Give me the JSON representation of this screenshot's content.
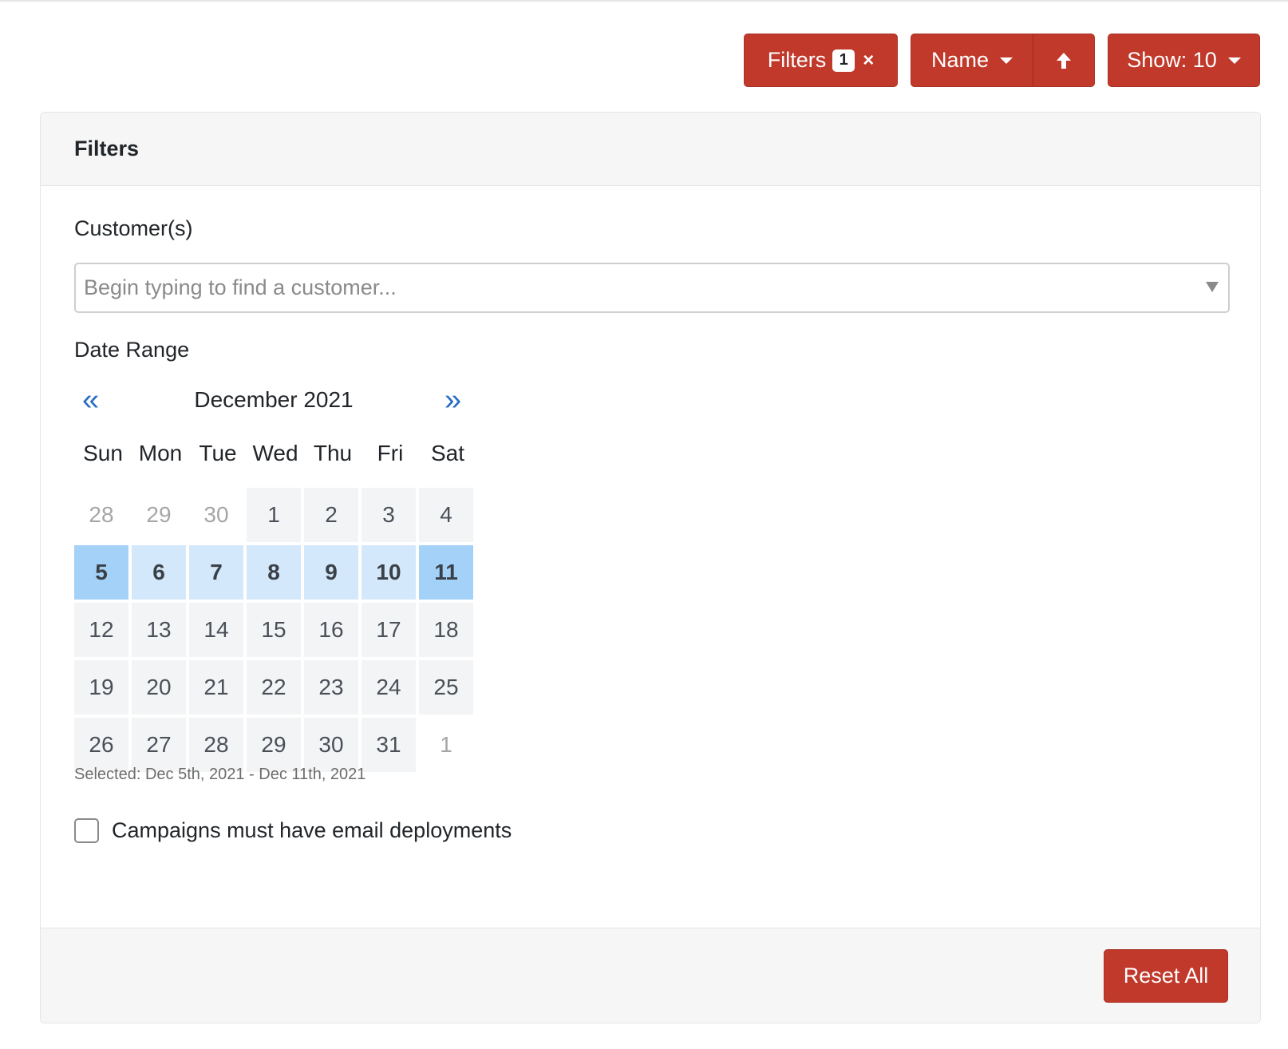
{
  "toolbar": {
    "filters_label": "Filters",
    "filters_count": "1",
    "clear_icon": "×",
    "sort_field_label": "Name",
    "sort_direction_icon": "🠅",
    "show_label": "Show: 10"
  },
  "filters_panel": {
    "title": "Filters",
    "customers_label": "Customer(s)",
    "customers_placeholder": "Begin typing to find a customer...",
    "date_range_label": "Date Range",
    "calendar": {
      "prev_icon": "«",
      "next_icon": "»",
      "month_title": "December 2021",
      "weekdays": [
        "Sun",
        "Mon",
        "Tue",
        "Wed",
        "Thu",
        "Fri",
        "Sat"
      ],
      "days": [
        {
          "label": "28",
          "state": "muted"
        },
        {
          "label": "29",
          "state": "muted"
        },
        {
          "label": "30",
          "state": "muted"
        },
        {
          "label": "1",
          "state": "normal"
        },
        {
          "label": "2",
          "state": "normal"
        },
        {
          "label": "3",
          "state": "normal"
        },
        {
          "label": "4",
          "state": "normal"
        },
        {
          "label": "5",
          "state": "edge"
        },
        {
          "label": "6",
          "state": "inrange"
        },
        {
          "label": "7",
          "state": "inrange"
        },
        {
          "label": "8",
          "state": "inrange"
        },
        {
          "label": "9",
          "state": "inrange"
        },
        {
          "label": "10",
          "state": "inrange"
        },
        {
          "label": "11",
          "state": "edge"
        },
        {
          "label": "12",
          "state": "normal"
        },
        {
          "label": "13",
          "state": "normal"
        },
        {
          "label": "14",
          "state": "normal"
        },
        {
          "label": "15",
          "state": "normal"
        },
        {
          "label": "16",
          "state": "normal"
        },
        {
          "label": "17",
          "state": "normal"
        },
        {
          "label": "18",
          "state": "normal"
        },
        {
          "label": "19",
          "state": "normal"
        },
        {
          "label": "20",
          "state": "normal"
        },
        {
          "label": "21",
          "state": "normal"
        },
        {
          "label": "22",
          "state": "normal"
        },
        {
          "label": "23",
          "state": "normal"
        },
        {
          "label": "24",
          "state": "normal"
        },
        {
          "label": "25",
          "state": "normal"
        },
        {
          "label": "26",
          "state": "normal"
        },
        {
          "label": "27",
          "state": "normal"
        },
        {
          "label": "28",
          "state": "normal"
        },
        {
          "label": "29",
          "state": "normal"
        },
        {
          "label": "30",
          "state": "normal"
        },
        {
          "label": "31",
          "state": "normal"
        },
        {
          "label": "1",
          "state": "muted"
        }
      ]
    },
    "selected_text": "Selected: Dec 5th, 2021 - Dec 11th, 2021",
    "email_checkbox_label": "Campaigns must have email deployments",
    "email_checkbox_checked": false,
    "reset_label": "Reset All"
  },
  "colors": {
    "primary_button": "#c0392b",
    "range_edge": "#a4d1f8",
    "range_inner": "#d3e8fb",
    "nav_arrow": "#2a6fc2"
  }
}
